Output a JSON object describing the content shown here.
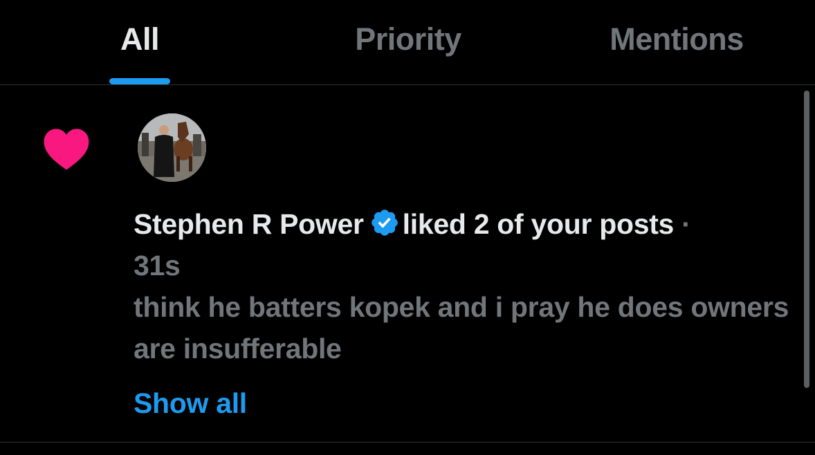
{
  "tabs": [
    {
      "label": "All",
      "active": true
    },
    {
      "label": "Priority",
      "active": false
    },
    {
      "label": "Mentions",
      "active": false
    }
  ],
  "notification": {
    "type_icon": "heart-icon",
    "icon_color": "#f91880",
    "user_name": "Stephen R Power",
    "verified": true,
    "action": "liked 2 of your posts",
    "separator": "·",
    "timestamp": "31s",
    "post_preview": "think he batters kopek and i pray he does owners are insufferable",
    "show_all_label": "Show all"
  },
  "colors": {
    "background": "#000000",
    "accent": "#1d9bf0",
    "primary_text": "#e7e9ea",
    "secondary_text": "#71767b",
    "like": "#f91880",
    "divider": "#2f3336"
  }
}
